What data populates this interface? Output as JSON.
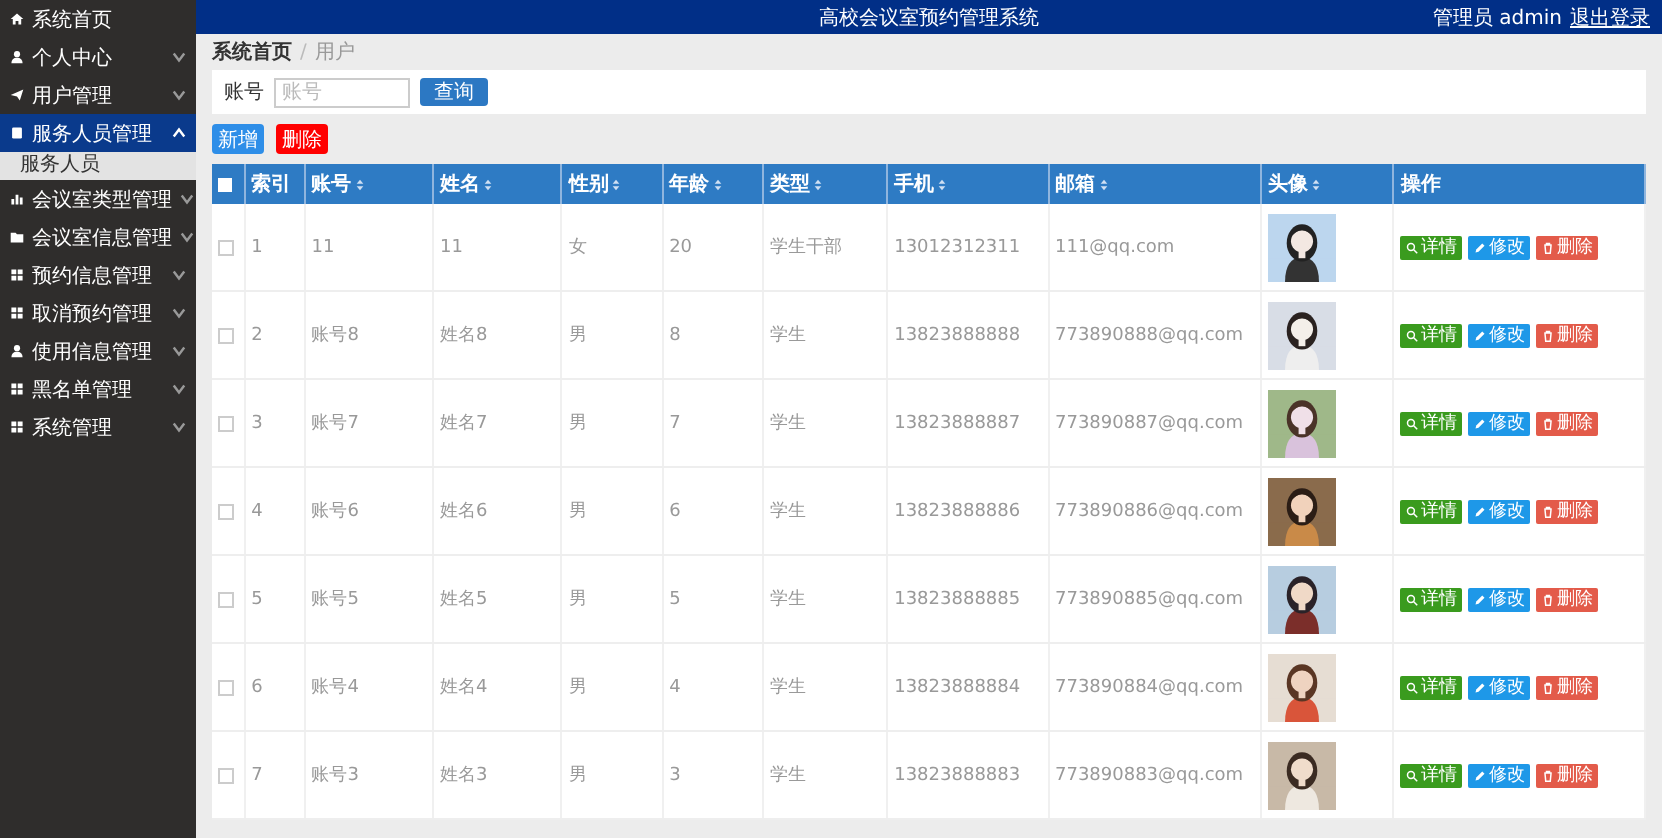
{
  "header": {
    "title": "高校会议室预约管理系统",
    "user": "管理员 admin",
    "logout": "退出登录"
  },
  "sidebar": {
    "items": [
      {
        "label": "系统首页",
        "selected": false
      },
      {
        "label": "个人中心",
        "selected": false,
        "expanded": false
      },
      {
        "label": "用户管理",
        "selected": false,
        "expanded": false
      },
      {
        "label": "服务人员管理",
        "selected": true,
        "expanded": true,
        "children": [
          {
            "label": "服务人员"
          }
        ]
      },
      {
        "label": "会议室类型管理",
        "selected": false,
        "expanded": false
      },
      {
        "label": "会议室信息管理",
        "selected": false,
        "expanded": false
      },
      {
        "label": "预约信息管理",
        "selected": false,
        "expanded": false
      },
      {
        "label": "取消预约管理",
        "selected": false,
        "expanded": false
      },
      {
        "label": "使用信息管理",
        "selected": false,
        "expanded": false
      },
      {
        "label": "黑名单管理",
        "selected": false,
        "expanded": false
      },
      {
        "label": "系统管理",
        "selected": false,
        "expanded": false
      }
    ]
  },
  "breadcrumb": {
    "items": [
      "系统首页",
      "用户"
    ],
    "separator": "/"
  },
  "search": {
    "label": "账号",
    "placeholder": "账号",
    "button": "查询"
  },
  "actions": {
    "add": "新增",
    "delete": "删除"
  },
  "table": {
    "select_all": {
      "checked": false
    },
    "columns": [
      {
        "label": "索引",
        "sortable": false
      },
      {
        "label": "账号",
        "sortable": true
      },
      {
        "label": "姓名",
        "sortable": true
      },
      {
        "label": "性别",
        "sortable": true
      },
      {
        "label": "年龄",
        "sortable": true
      },
      {
        "label": "类型",
        "sortable": true
      },
      {
        "label": "手机",
        "sortable": true
      },
      {
        "label": "邮箱",
        "sortable": true
      },
      {
        "label": "头像",
        "sortable": true
      },
      {
        "label": "操作",
        "sortable": false
      }
    ],
    "rows": [
      {
        "checked": false,
        "cells": [
          "1",
          "11",
          "11",
          "女",
          "20",
          "学生干部",
          "13012312311",
          "111@qq.com"
        ],
        "buttons": [
          "详情",
          "修改",
          "删除"
        ]
      },
      {
        "checked": false,
        "cells": [
          "2",
          "账号8",
          "姓名8",
          "男",
          "8",
          "学生",
          "13823888888",
          "773890888@qq.com"
        ],
        "buttons": [
          "详情",
          "修改",
          "删除"
        ]
      },
      {
        "checked": false,
        "cells": [
          "3",
          "账号7",
          "姓名7",
          "男",
          "7",
          "学生",
          "13823888887",
          "773890887@qq.com"
        ],
        "buttons": [
          "详情",
          "修改",
          "删除"
        ]
      },
      {
        "checked": false,
        "cells": [
          "4",
          "账号6",
          "姓名6",
          "男",
          "6",
          "学生",
          "13823888886",
          "773890886@qq.com"
        ],
        "buttons": [
          "详情",
          "修改",
          "删除"
        ]
      },
      {
        "checked": false,
        "cells": [
          "5",
          "账号5",
          "姓名5",
          "男",
          "5",
          "学生",
          "13823888885",
          "773890885@qq.com"
        ],
        "buttons": [
          "详情",
          "修改",
          "删除"
        ]
      },
      {
        "checked": false,
        "cells": [
          "6",
          "账号4",
          "姓名4",
          "男",
          "4",
          "学生",
          "13823888884",
          "773890884@qq.com"
        ],
        "buttons": [
          "详情",
          "修改",
          "删除"
        ]
      },
      {
        "checked": false,
        "cells": [
          "7",
          "账号3",
          "姓名3",
          "男",
          "3",
          "学生",
          "13823888883",
          "773890883@qq.com"
        ],
        "buttons": [
          "详情",
          "修改",
          "删除"
        ]
      }
    ]
  }
}
